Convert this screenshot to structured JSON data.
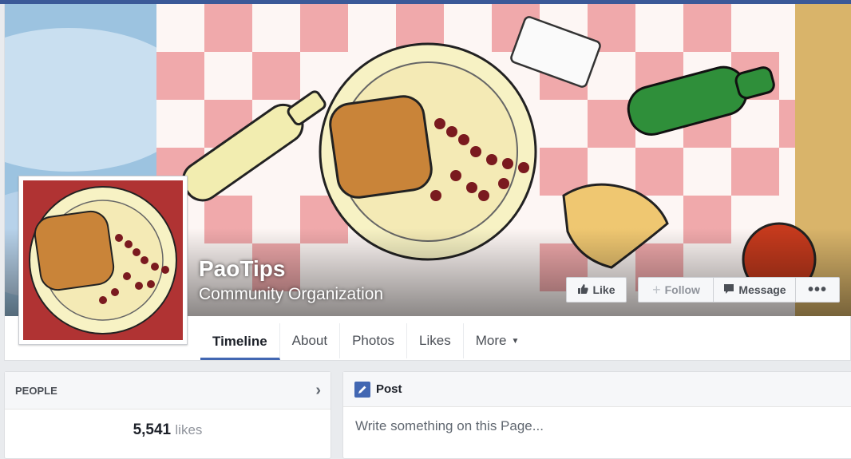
{
  "page": {
    "name": "PaoTips",
    "category": "Community Organization"
  },
  "actions": {
    "like_label": "Like",
    "follow_label": "Follow",
    "message_label": "Message",
    "more_icon": "ellipsis-icon"
  },
  "tabs": [
    {
      "label": "Timeline",
      "active": true
    },
    {
      "label": "About",
      "active": false
    },
    {
      "label": "Photos",
      "active": false
    },
    {
      "label": "Likes",
      "active": false
    },
    {
      "label": "More",
      "active": false
    }
  ],
  "people": {
    "heading": "PEOPLE",
    "likes_count": "5,541",
    "likes_label": "likes"
  },
  "composer": {
    "heading": "Post",
    "placeholder": "Write something on this Page..."
  },
  "colors": {
    "brand_blue": "#3b5998",
    "tab_underline": "#4267b2"
  }
}
